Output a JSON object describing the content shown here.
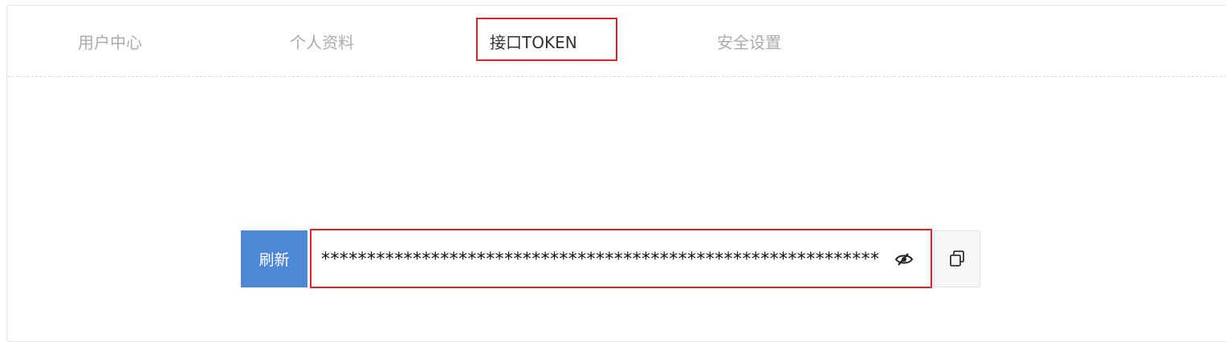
{
  "tabs": [
    {
      "label": "用户中心",
      "active": false
    },
    {
      "label": "个人资料",
      "active": false
    },
    {
      "label": "接口TOKEN",
      "active": true
    },
    {
      "label": "安全设置",
      "active": false
    }
  ],
  "token": {
    "refresh_label": "刷新",
    "masked_value": "**************************************************************",
    "toggle_icon": "eye-slash-icon",
    "copy_icon": "copy-icon"
  },
  "colors": {
    "accent": "#4e88d4",
    "highlight": "#e2222a",
    "tab_inactive": "#a8acb0",
    "tab_active": "#333333"
  }
}
